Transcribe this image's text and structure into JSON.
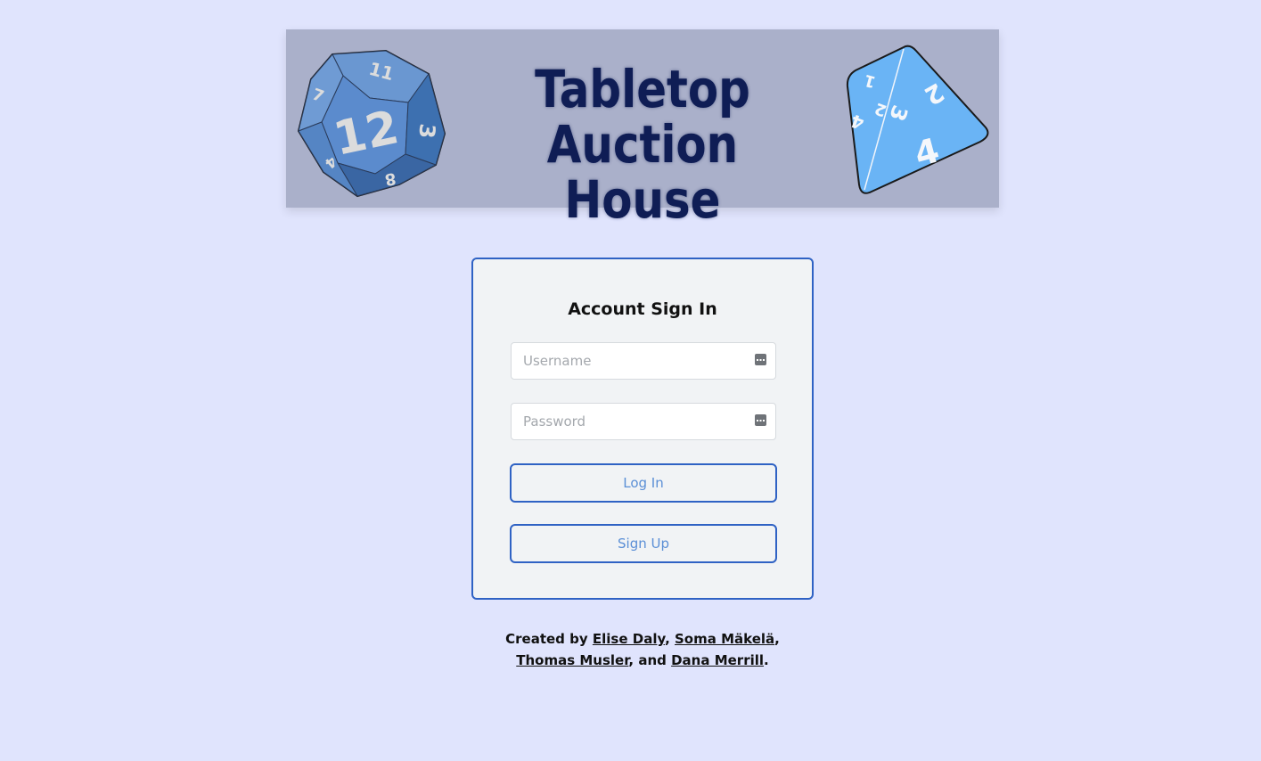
{
  "header": {
    "title": "Tabletop Auction House",
    "d12_top_face": "12",
    "d12_faces": [
      "11",
      "7",
      "3",
      "8",
      "4"
    ],
    "d4_faces": [
      "2",
      "4",
      "3",
      "2",
      "1",
      "4"
    ]
  },
  "login": {
    "title": "Account Sign In",
    "username": {
      "placeholder": "Username",
      "value": ""
    },
    "password": {
      "placeholder": "Password",
      "value": ""
    },
    "login_label": "Log In",
    "signup_label": "Sign Up"
  },
  "footer": {
    "prefix": "Created by",
    "authors": [
      "Elise Daly",
      "Soma Mäkelä",
      "Thomas Musler",
      "Dana Merrill"
    ],
    "sep1": ", ",
    "sep2": ", ",
    "sep3": ", and ",
    "end": "."
  },
  "colors": {
    "page_bg": "#e0e4fd",
    "banner_bg": "#aab0ca",
    "title": "#0f1d55",
    "accent": "#2f62c4",
    "button_text": "#5b8fd6",
    "d12": "#4a7fc1",
    "d4": "#6ab4f5"
  }
}
